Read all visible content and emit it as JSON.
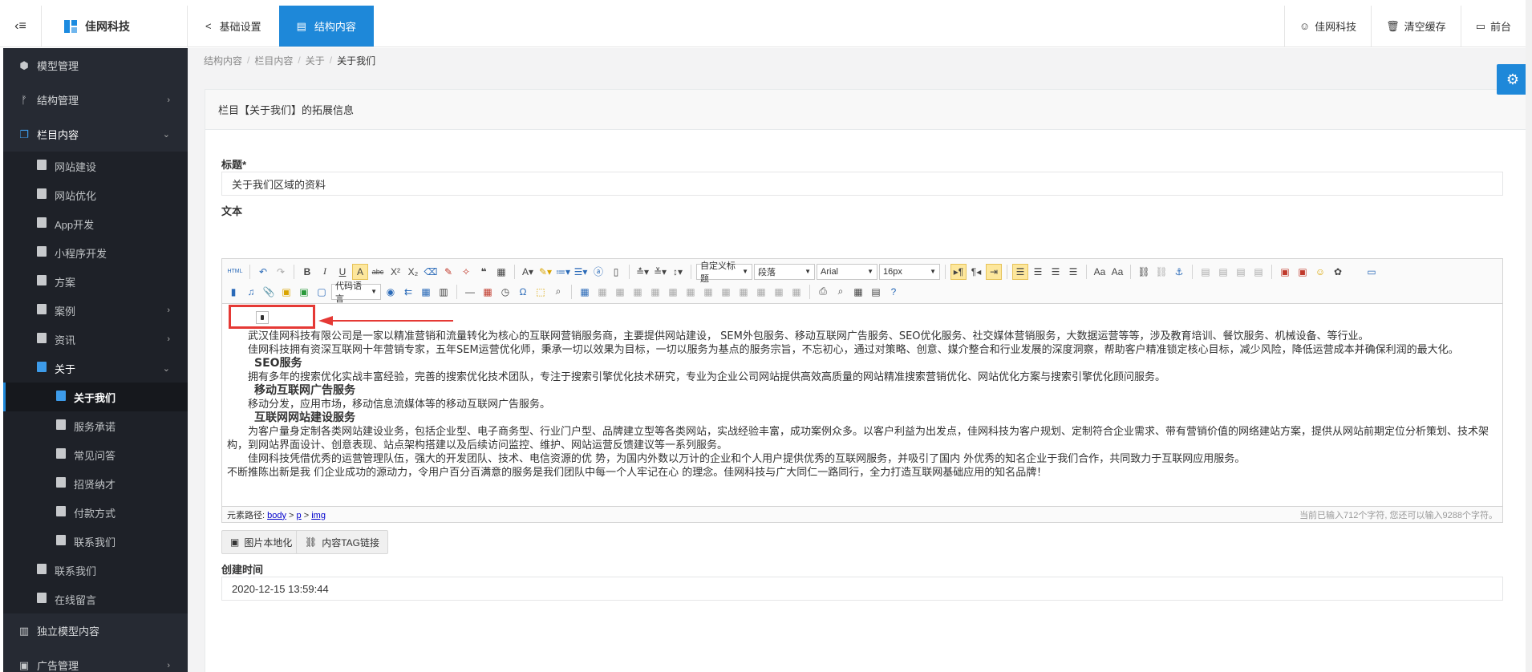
{
  "topbar": {
    "brand": "佳网科技",
    "tabs": [
      {
        "label": "基础设置",
        "icon": "share-icon"
      },
      {
        "label": "结构内容",
        "icon": "document-icon"
      }
    ],
    "right": [
      {
        "label": "佳网科技",
        "icon": "user-icon"
      },
      {
        "label": "清空缓存",
        "icon": "trash-icon"
      },
      {
        "label": "前台",
        "icon": "monitor-icon"
      }
    ]
  },
  "sidebar": {
    "items": [
      {
        "label": "模型管理"
      },
      {
        "label": "结构管理"
      },
      {
        "label": "栏目内容"
      },
      {
        "label": "网站建设"
      },
      {
        "label": "网站优化"
      },
      {
        "label": "App开发"
      },
      {
        "label": "小程序开发"
      },
      {
        "label": "方案"
      },
      {
        "label": "案例"
      },
      {
        "label": "资讯"
      },
      {
        "label": "关于"
      },
      {
        "label": "关于我们"
      },
      {
        "label": "服务承诺"
      },
      {
        "label": "常见问答"
      },
      {
        "label": "招贤纳才"
      },
      {
        "label": "付款方式"
      },
      {
        "label": "联系我们"
      },
      {
        "label": "联系我们"
      },
      {
        "label": "在线留言"
      },
      {
        "label": "独立模型内容"
      },
      {
        "label": "广告管理"
      }
    ]
  },
  "breadcrumb": [
    "结构内容",
    "栏目内容",
    "关于",
    "关于我们"
  ],
  "panel": {
    "heading": "栏目【关于我们】的拓展信息"
  },
  "form": {
    "title_label": "标题*",
    "title_value": "关于我们区域的资料",
    "text_label": "文本",
    "created_label": "创建时间",
    "created_value": "2020-12-15 13:59:44"
  },
  "editor": {
    "selects": {
      "custom_title": "自定义标题",
      "paragraph": "段落",
      "font": "Arial",
      "size": "16px",
      "code_lang": "代码语言"
    },
    "content": {
      "p1": "武汉佳网科技有限公司是一家以精准营销和流量转化为核心的互联网营销服务商，主要提供网站建设， SEM外包服务、移动互联网广告服务、SEO优化服务、社交媒体营销服务，大数据运营等等，涉及教育培训、餐饮服务、机械设备、等行业。",
      "p2": "佳网科技拥有资深互联网十年营销专家，五年SEM运营优化师，秉承一切以效果为目标，一切以服务为基点的服务宗旨，不忘初心，通过对策略、创意、媒介整合和行业发展的深度洞察，帮助客户精准锁定核心目标，减少风险，降低运营成本并确保利润的最大化。",
      "h1": "SEO服务",
      "p3": "拥有多年的搜索优化实战丰富经验，完善的搜索优化技术团队，专注于搜索引擎优化技术研究，专业为企业公司网站提供高效高质量的网站精准搜索营销优化、网站优化方案与搜索引擎优化顾问服务。",
      "h2": "移动互联网广告服务",
      "p4": "移动分发，应用市场，移动信息流媒体等的移动互联网广告服务。",
      "h3": "互联网网站建设服务",
      "p5": "为客户量身定制各类网站建设业务，包括企业型、电子商务型、行业门户型、品牌建立型等各类网站，实战经验丰富，成功案例众多。以客户利益为出发点，佳网科技为客户规划、定制符合企业需求、带有营销价值的网络建站方案，提供从网站前期定位分析策划、技术架构，到网站界面设计、创意表现、站点架构搭建以及后续访问监控、维护、网站运营反馈建议等一系列服务。",
      "p6a": "佳网科技凭借优秀的运营管理队伍，强大的开发团队、技术、电信资源的优 势，为国内外数以万计的企业和个人用户提供优秀的互联网服务，并吸引了国内 外优秀的知名企业于我们合作，共同致力于互联网应用服务。",
      "p6b": "不断推陈出新是我 们企业成功的源动力，令用户百分百满意的服务是我们团队中每一个人牢记在心 的理念。佳网科技与广大同仁一路同行，全力打造互联网基础应用的知名品牌！"
    },
    "status": {
      "path_label": "元素路径:",
      "path": [
        "body",
        "p",
        "img"
      ],
      "path_sep": ">",
      "count": "当前已输入712个字符, 您还可以输入9288个字符。"
    }
  },
  "buttons": {
    "localize_images": "图片本地化",
    "tag_link": "内容TAG链接"
  }
}
